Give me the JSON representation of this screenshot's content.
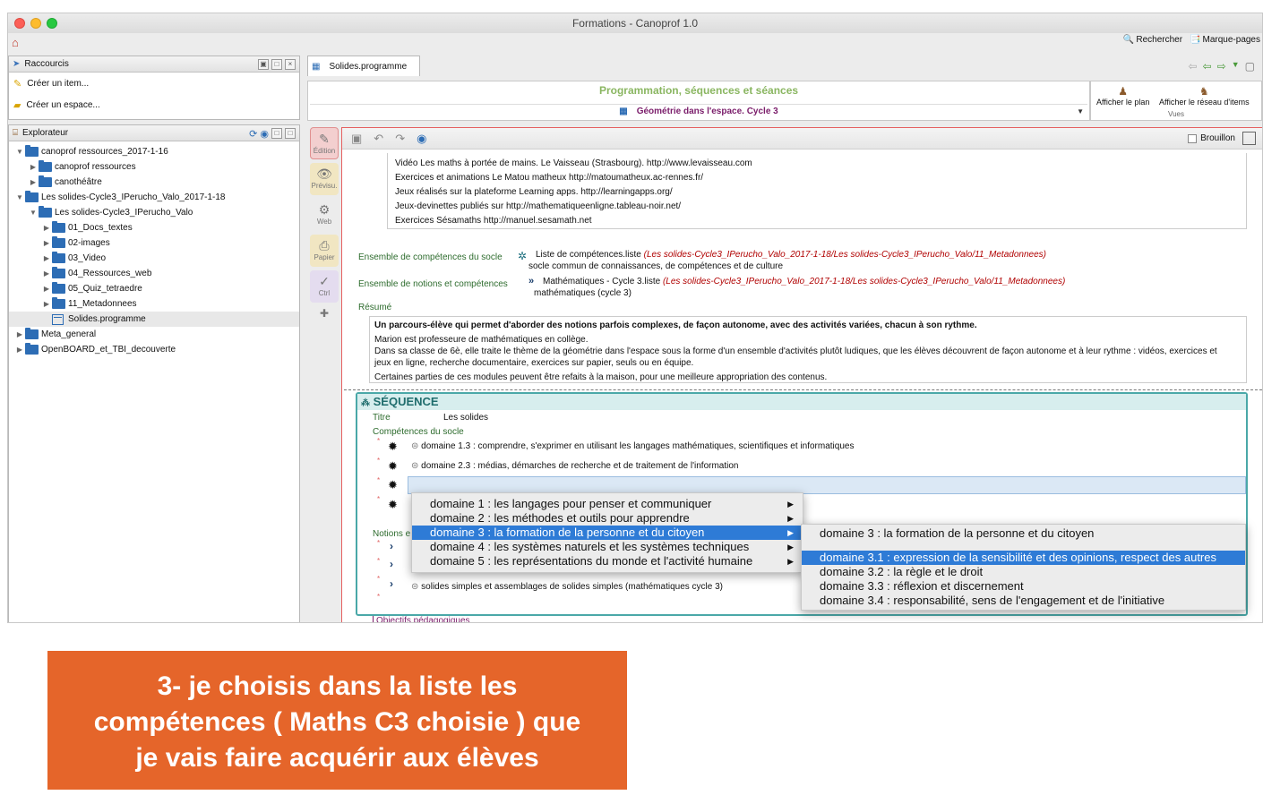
{
  "window": {
    "title": "Formations - Canoprof 1.0"
  },
  "topbar": {
    "search_label": "Rechercher",
    "bookmarks_label": "Marque-pages"
  },
  "shortcuts": {
    "header": "Raccourcis",
    "items": [
      "Créer un item...",
      "Créer un espace..."
    ]
  },
  "explorer": {
    "header": "Explorateur",
    "tree": [
      {
        "label": "canoprof ressources_2017-1-16",
        "level": 0,
        "expanded": true,
        "type": "folder"
      },
      {
        "label": "canoprof ressources",
        "level": 1,
        "expanded": false,
        "type": "folder"
      },
      {
        "label": "canothéâtre",
        "level": 1,
        "expanded": false,
        "type": "folder"
      },
      {
        "label": "Les solides-Cycle3_IPerucho_Valo_2017-1-18",
        "level": 0,
        "expanded": true,
        "type": "folder"
      },
      {
        "label": "Les solides-Cycle3_IPerucho_Valo",
        "level": 1,
        "expanded": true,
        "type": "folder"
      },
      {
        "label": "01_Docs_textes",
        "level": 2,
        "expanded": false,
        "type": "folder"
      },
      {
        "label": "02-images",
        "level": 2,
        "expanded": false,
        "type": "folder"
      },
      {
        "label": "03_Video",
        "level": 2,
        "expanded": false,
        "type": "folder"
      },
      {
        "label": "04_Ressources_web",
        "level": 2,
        "expanded": false,
        "type": "folder"
      },
      {
        "label": "05_Quiz_tetraedre",
        "level": 2,
        "expanded": false,
        "type": "folder"
      },
      {
        "label": "11_Metadonnees",
        "level": 2,
        "expanded": false,
        "type": "folder"
      },
      {
        "label": "Solides.programme",
        "level": 2,
        "expanded": null,
        "type": "file",
        "selected": true
      },
      {
        "label": "Meta_general",
        "level": 0,
        "expanded": false,
        "type": "folder"
      },
      {
        "label": "OpenBOARD_et_TBI_decouverte",
        "level": 0,
        "expanded": false,
        "type": "folder"
      }
    ]
  },
  "tab": {
    "label": "Solides.programme"
  },
  "header": {
    "title": "Programmation, séquences et séances",
    "subtitle": "Géométrie dans l'espace. Cycle 3"
  },
  "views": {
    "plan_label": "Afficher le plan",
    "network_label": "Afficher le réseau d'items",
    "group_label": "Vues"
  },
  "leftbar": {
    "edition": "Édition",
    "preview": "Prévisu.",
    "web": "Web",
    "paper": "Papier",
    "ctrl": "Ctrl"
  },
  "editor": {
    "brouillon_label": "Brouillon",
    "resources": [
      "Vidéo Les maths à portée de mains. Le Vaisseau (Strasbourg). http://www.levaisseau.com",
      "Exercices et animations Le Matou matheux http://matoumatheux.ac-rennes.fr/",
      "Jeux réalisés sur la plateforme Learning apps. http://learningapps.org/",
      "Jeux-devinettes publiés sur http://mathematiqueenligne.tableau-noir.net/",
      "Exercices Sésamaths http://manuel.sesamath.net"
    ],
    "socle_label": "Ensemble de compétences du socle",
    "socle_file": "Liste de compétences.liste",
    "socle_path": "(Les solides-Cycle3_IPerucho_Valo_2017-1-18/Les solides-Cycle3_IPerucho_Valo/11_Metadonnees)",
    "socle_desc": "socle commun de connaissances, de compétences et de culture",
    "notions_label": "Ensemble de notions et compétences",
    "notions_file": "Mathématiques - Cycle 3.liste",
    "notions_path": "(Les solides-Cycle3_IPerucho_Valo_2017-1-18/Les solides-Cycle3_IPerucho_Valo/11_Metadonnees)",
    "notions_desc": "mathématiques (cycle 3)",
    "resume_label": "Résumé",
    "resume_bold": "Un parcours-élève qui permet d'aborder des notions parfois complexes, de façon autonome, avec des activités variées, chacun à son rythme.",
    "resume_lines": [
      "Marion est professeure de mathématiques en collège.",
      "Dans sa classe de 6è, elle traite le thème de la géométrie dans l'espace sous la forme d'un ensemble d'activités plutôt ludiques, que les élèves découvrent de façon autonome et à leur rythme : vidéos, exercices et",
      "jeux en ligne, recherche documentaire, exercices sur papier, seuls ou en équipe.",
      "Certaines parties de ces modules peuvent être refaits à la maison, pour une meilleure appropriation des contenus."
    ],
    "sequence": {
      "header": "SÉQUENCE",
      "titre_label": "Titre",
      "titre_value": "Les solides",
      "competences_label": "Compétences du socle",
      "competences": [
        "domaine 1.3 : comprendre, s'exprimer en utilisant les langages mathématiques, scientifiques et informatiques",
        "domaine 2.3 : médias, démarches de recherche et de traitement de l'information"
      ],
      "notions_label": "Notions e",
      "notion_item": "solides simples et assemblages de solides simples (mathématiques cycle 3)",
      "objectifs_label": "Objectifs pédagogiques"
    }
  },
  "menu_main": [
    {
      "label": "domaine 1 : les langages pour penser et communiquer",
      "highlight": false
    },
    {
      "label": "domaine 2 : les méthodes et outils pour apprendre",
      "highlight": false
    },
    {
      "label": "domaine 3 : la formation de la personne et du citoyen",
      "highlight": true
    },
    {
      "label": "domaine 4 : les systèmes naturels et les systèmes techniques",
      "highlight": false
    },
    {
      "label": "domaine 5 : les représentations du monde et l'activité humaine",
      "highlight": false
    }
  ],
  "menu_sub": {
    "header": "domaine 3 : la formation de la personne et du citoyen",
    "items": [
      {
        "label": "domaine 3.1 : expression de la sensibilité et des opinions, respect des autres",
        "highlight": true
      },
      {
        "label": "domaine 3.2 : la règle et le droit",
        "highlight": false
      },
      {
        "label": "domaine 3.3 : réflexion et discernement",
        "highlight": false
      },
      {
        "label": "domaine 3.4 : responsabilité, sens de l'engagement et de l'initiative",
        "highlight": false
      }
    ]
  },
  "callout": {
    "lines": [
      "3- je choisis dans la liste les",
      "compétences ( Maths C3 choisie ) que",
      "je vais faire acquérir aux élèves"
    ]
  },
  "colors": {
    "accent": "#2e7bd6",
    "callout": "#e5652a",
    "teal": "#4aa8a8",
    "title_green": "#8ab661"
  }
}
